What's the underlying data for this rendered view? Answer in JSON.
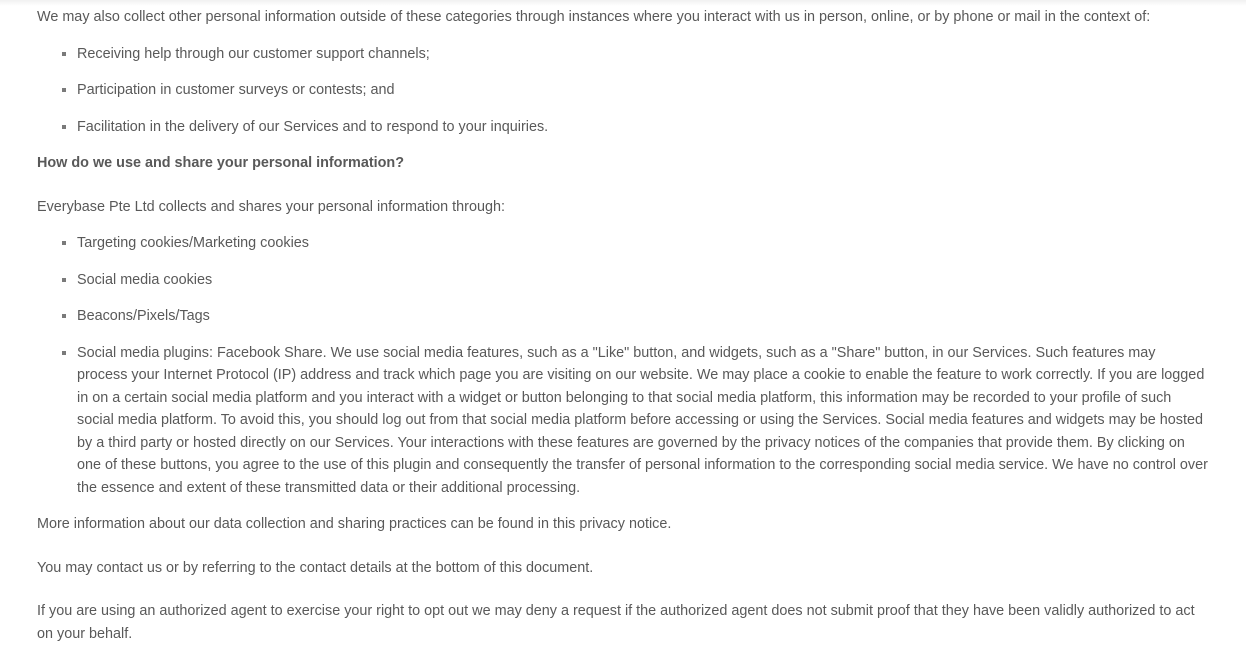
{
  "intro": "We may also collect other personal information outside of these categories through instances where you interact with us in person, online, or by phone or mail in the context of:",
  "contexts": [
    "Receiving help through our customer support channels;",
    "Participation in customer surveys or contests; and",
    "Facilitation in the delivery of our Services and to respond to your inquiries."
  ],
  "heading": "How do we use and share your personal information?",
  "collects": "Everybase Pte Ltd collects and shares your personal information through:",
  "methods": [
    "Targeting cookies/Marketing cookies",
    "Social media cookies",
    "Beacons/Pixels/Tags",
    "Social media plugins: Facebook Share. We use social media features, such as a \"Like\" button, and widgets, such as a \"Share\" button, in our Services. Such features may process your Internet Protocol (IP) address and track which page you are visiting on our website. We may place a cookie to enable the feature to work correctly. If you are logged in on a certain social media platform and you interact with a widget or button belonging to that social media platform, this information may be recorded to your profile of such social media platform. To avoid this, you should log out from that social media platform before accessing or using the Services. Social media features and widgets may be hosted by a third party or hosted directly on our Services. Your interactions with these features are governed by the privacy notices of the companies that provide them. By clicking on one of these buttons, you agree to the use of this plugin and consequently the transfer of personal information to the corresponding social media service. We have no control over the essence and extent of these transmitted data or their additional processing."
  ],
  "more_info": "More information about our data collection and sharing practices can be found in this privacy notice.",
  "contact": "You may contact us or by referring to the contact details at the bottom of this document.",
  "agent": "If you are using an authorized agent to exercise your right to opt out we may deny a request if the authorized agent does not submit proof that they have been validly authorized to act on your behalf."
}
